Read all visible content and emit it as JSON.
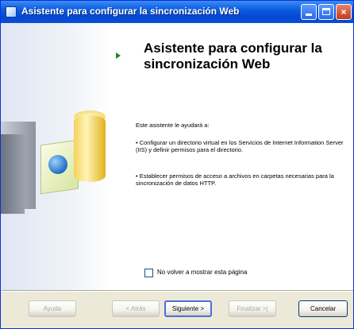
{
  "window": {
    "title": "Asistente para configurar la sincronización Web",
    "title_icon": "wizard-icon",
    "controls": [
      "minimize-icon",
      "maximize-icon",
      "close-icon"
    ],
    "close_glyph": "×"
  },
  "main": {
    "heading": "Asistente para configurar la sincronización Web",
    "intro": "Este asistente le ayudará a:",
    "bullets": [
      "• Configurar un directorio virtual en los Servicios de Internet Information Server (IIS) y definir permisos para el directorio.",
      "• Establecer permisos de acceso a archivos en carpetas necesarias para la sincronización de datos HTTP."
    ],
    "checkbox_label": "No volver a mostrar esta página",
    "checkbox_checked": false
  },
  "buttons": {
    "help": "Ayuda",
    "back": "< Atrás",
    "next": "Siguiente >",
    "finish": "Finalizar >|",
    "cancel": "Cancelar"
  },
  "colors": {
    "titlebar": "#0a5de0",
    "step_arrow": "#1d8a2a"
  }
}
